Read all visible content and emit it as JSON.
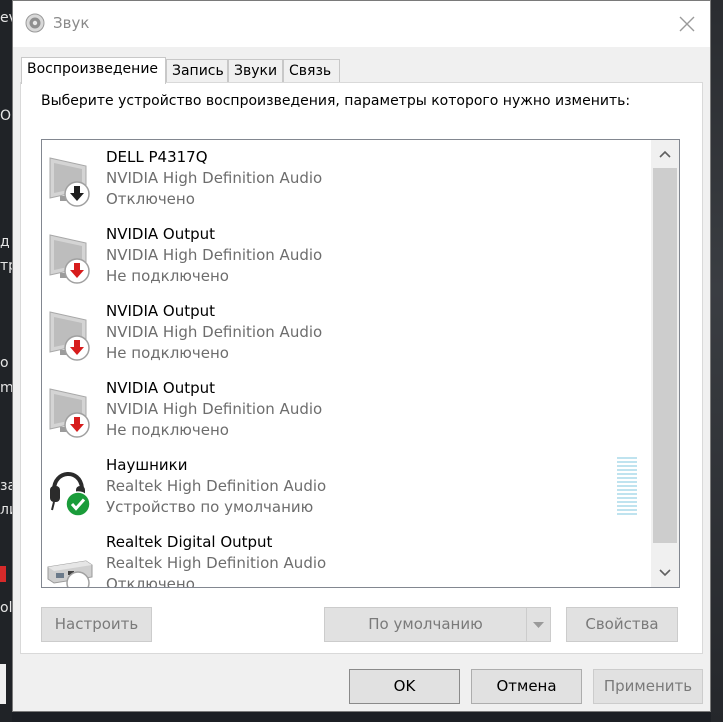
{
  "window": {
    "title": "Звук",
    "title_icon": "speaker-icon",
    "close_icon": "close-icon"
  },
  "tabs": [
    {
      "label": "Воспроизведение",
      "active": true
    },
    {
      "label": "Запись",
      "active": false
    },
    {
      "label": "Звуки",
      "active": false
    },
    {
      "label": "Связь",
      "active": false
    }
  ],
  "instruction": "Выберите устройство воспроизведения, параметры которого нужно изменить:",
  "devices": [
    {
      "name": "DELL P4317Q",
      "driver": "NVIDIA High Definition Audio",
      "status": "Отключено",
      "icon": "monitor-disabled-icon"
    },
    {
      "name": "NVIDIA Output",
      "driver": "NVIDIA High Definition Audio",
      "status": "Не подключено",
      "icon": "monitor-unplugged-icon"
    },
    {
      "name": "NVIDIA Output",
      "driver": "NVIDIA High Definition Audio",
      "status": "Не подключено",
      "icon": "monitor-unplugged-icon"
    },
    {
      "name": "NVIDIA Output",
      "driver": "NVIDIA High Definition Audio",
      "status": "Не подключено",
      "icon": "monitor-unplugged-icon"
    },
    {
      "name": "Наушники",
      "driver": "Realtek High Definition Audio",
      "status": "Устройство по умолчанию",
      "icon": "headphones-default-icon"
    },
    {
      "name": "Realtek Digital Output",
      "driver": "Realtek High Definition Audio",
      "status": "Отключено",
      "icon": "digital-output-icon"
    }
  ],
  "buttons": {
    "configure": "Настроить",
    "set_default": "По умолчанию",
    "properties": "Свойства",
    "ok": "OK",
    "cancel": "Отмена",
    "apply": "Применить"
  },
  "colors": {
    "arrow_red": "#d71c1c",
    "check_green": "#1a9c3a"
  }
}
